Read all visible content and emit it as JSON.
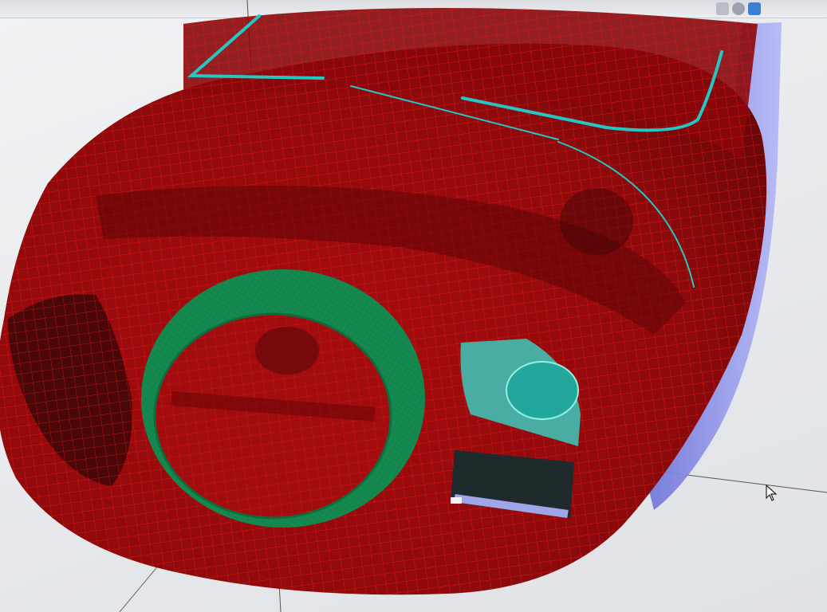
{
  "app": {
    "viewport_name": ""
  },
  "toolbar": {
    "icons": [
      "toolbar-icon",
      "toolbar-icon",
      "help-icon"
    ]
  },
  "model": {
    "description_colors": {
      "surface_wire": "#d21111",
      "surface_fill": "#9c0a0c",
      "lens_ring": "#169a5a",
      "edge_curve": "#24c7c4",
      "side_panel": "#8f95ef",
      "window_glass": "#3fbfb4"
    }
  },
  "cursor": {
    "icon": "mouse-pointer-icon"
  }
}
